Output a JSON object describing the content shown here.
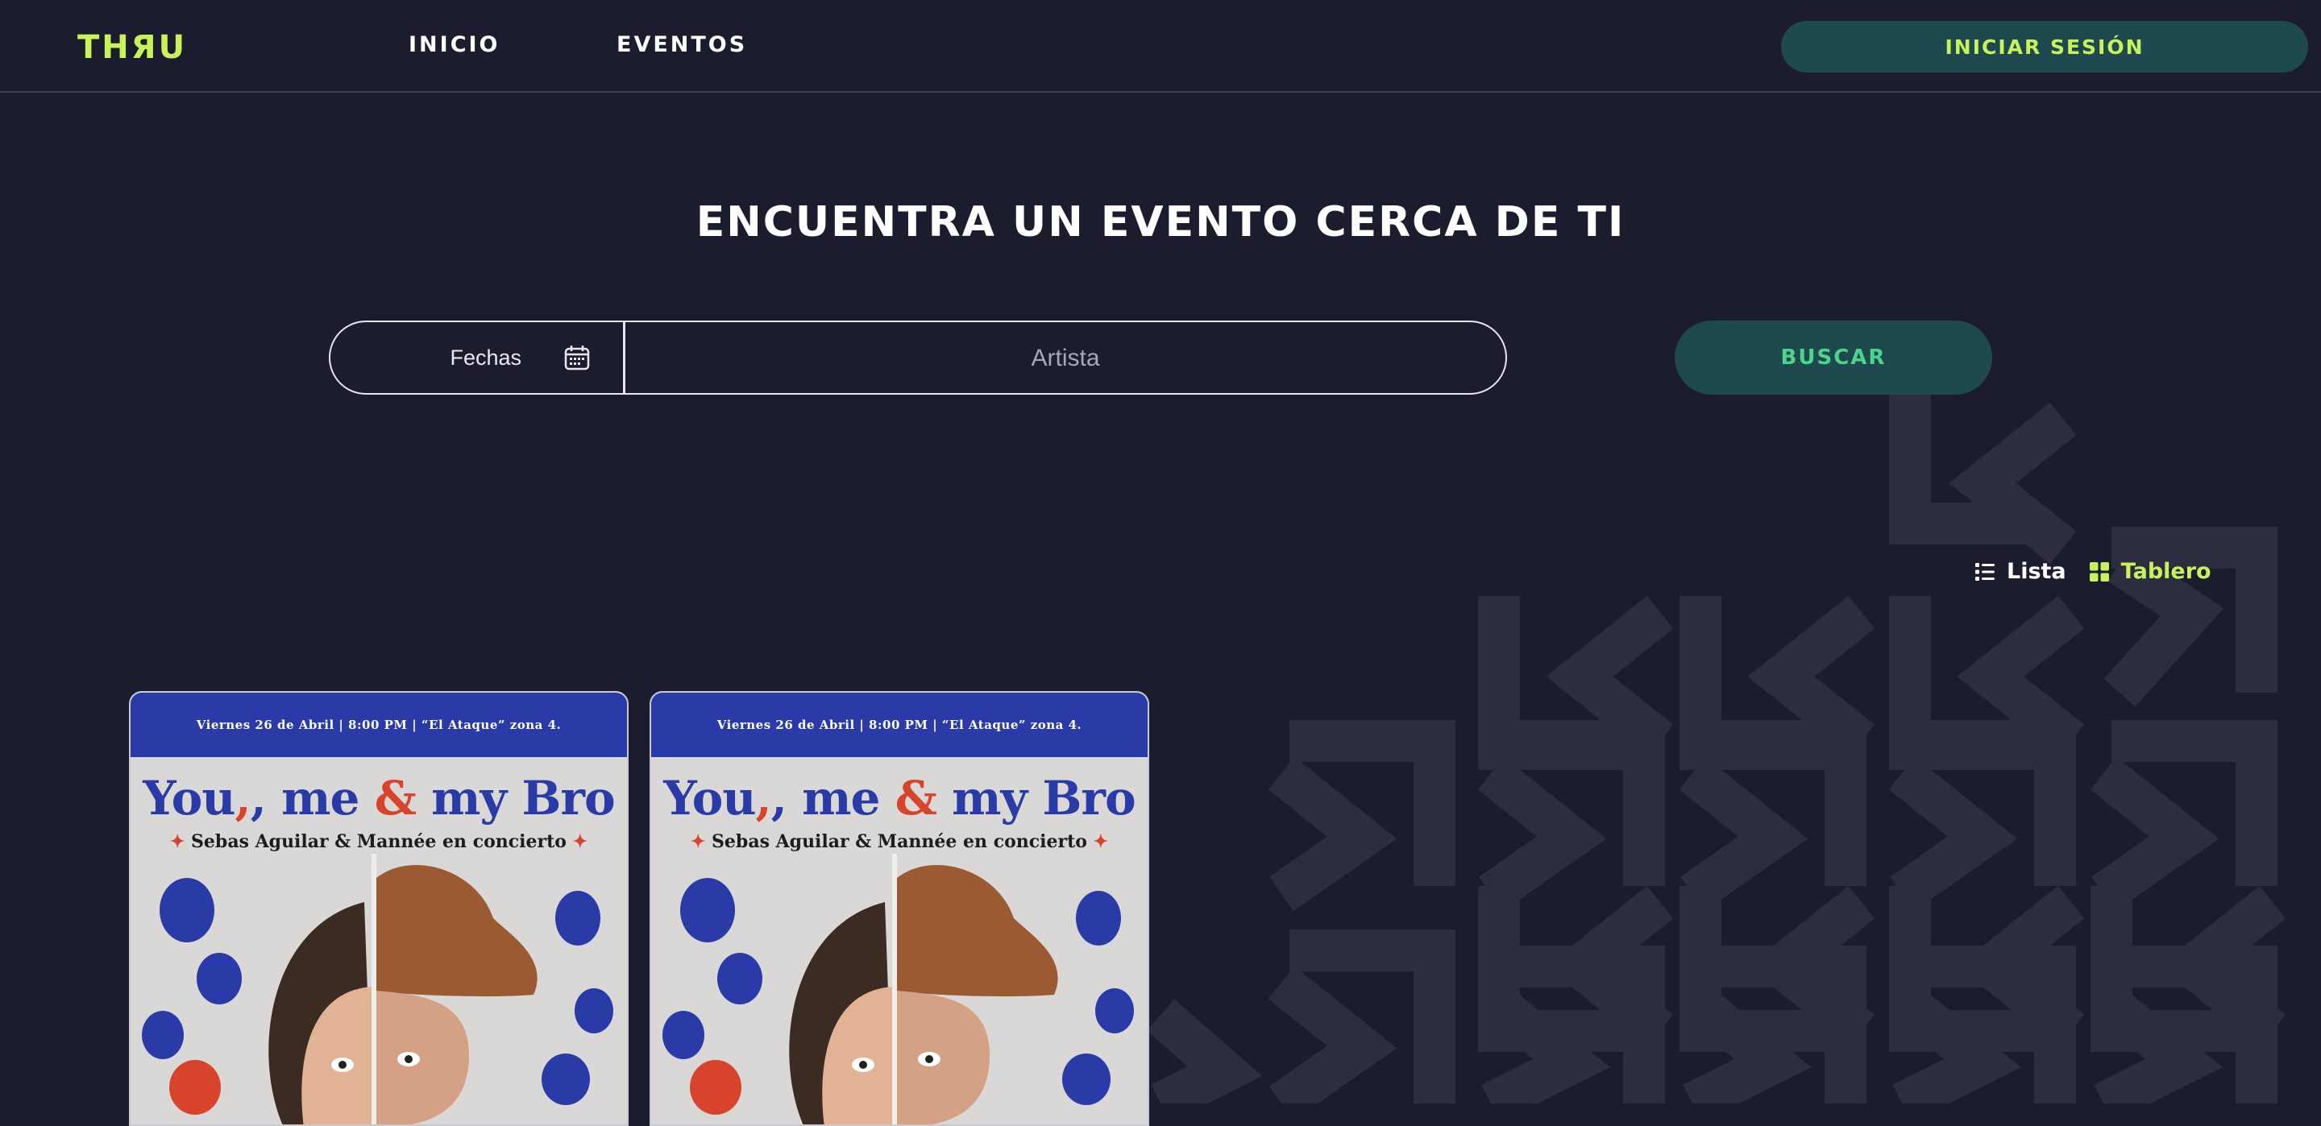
{
  "header": {
    "logo": "THЯU",
    "nav": [
      {
        "label": "INICIO"
      },
      {
        "label": "EVENTOS"
      }
    ],
    "login_label": "INICIAR SESIÓN"
  },
  "hero": {
    "title": "ENCUENTRA UN EVENTO CERCA DE TI"
  },
  "search": {
    "date_label": "Fechas",
    "artist_placeholder": "Artista",
    "button_label": "BUSCAR"
  },
  "view_toggle": {
    "list_label": "Lista",
    "board_label": "Tablero",
    "active": "Tablero"
  },
  "events": [
    {
      "info_line": "Viernes 26 de Abril  |  8:00 PM  |  “El Ataque” zona 4.",
      "title_part1": "You",
      "title_part2": ", me ",
      "title_amp": "&",
      "title_part3": " my Bro",
      "subtitle": "Sebas Aguilar & Mannée en concierto"
    },
    {
      "info_line": "Viernes 26 de Abril  |  8:00 PM  |  “El Ataque” zona 4.",
      "title_part1": "You",
      "title_part2": ", me ",
      "title_amp": "&",
      "title_part3": " my Bro",
      "subtitle": "Sebas Aguilar & Mannée en concierto"
    }
  ],
  "colors": {
    "background": "#1b1c2e",
    "accent": "#c8f25a",
    "button_bg": "#1e4a4f",
    "search_text": "#4ed38b",
    "poster_blue": "#2a3aa6",
    "poster_red": "#d8432c"
  }
}
